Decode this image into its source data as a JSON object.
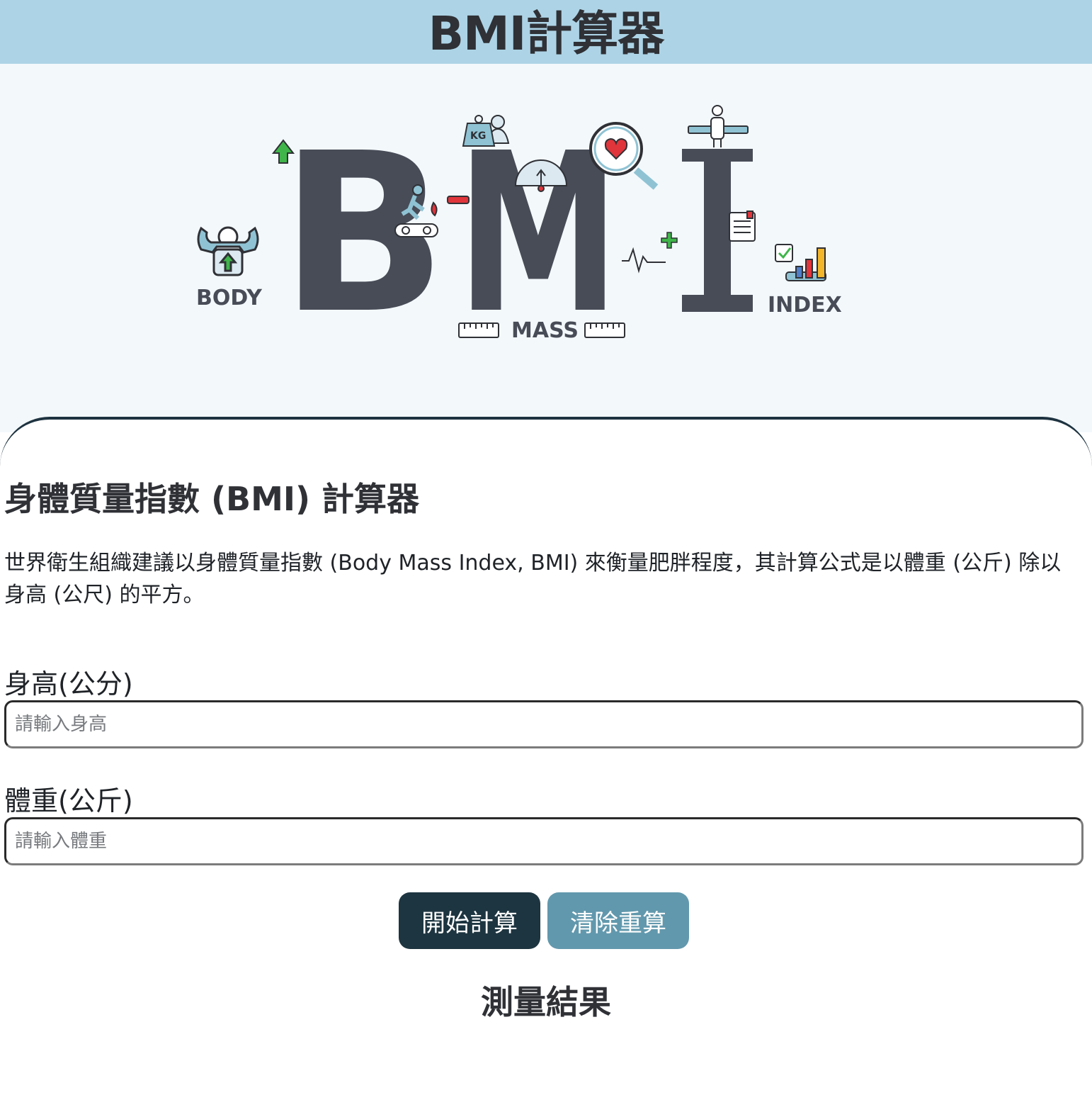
{
  "header": {
    "title": "BMI計算器"
  },
  "hero": {
    "letters": [
      "B",
      "M",
      "I"
    ],
    "label_body": "BODY",
    "label_mass": "MASS",
    "label_index": "INDEX",
    "weight_tag": "KG",
    "colors": {
      "letter": "#474c57",
      "green": "#3fb54a",
      "red": "#e0353b",
      "teal": "#8fc3d4",
      "yellow": "#f3b52a",
      "blue": "#4f7fc8"
    }
  },
  "main": {
    "title": "身體質量指數 (BMI) 計算器",
    "intro": "世界衛生組織建議以身體質量指數 (Body Mass Index, BMI) 來衡量肥胖程度，其計算公式是以體重 (公斤) 除以身高 (公尺) 的平方。"
  },
  "form": {
    "height_label": "身高(公分)",
    "height_placeholder": "請輸入身高",
    "weight_label": "體重(公斤)",
    "weight_placeholder": "請輸入體重",
    "calc_label": "開始計算",
    "clear_label": "清除重算"
  },
  "result": {
    "title": "測量結果"
  }
}
